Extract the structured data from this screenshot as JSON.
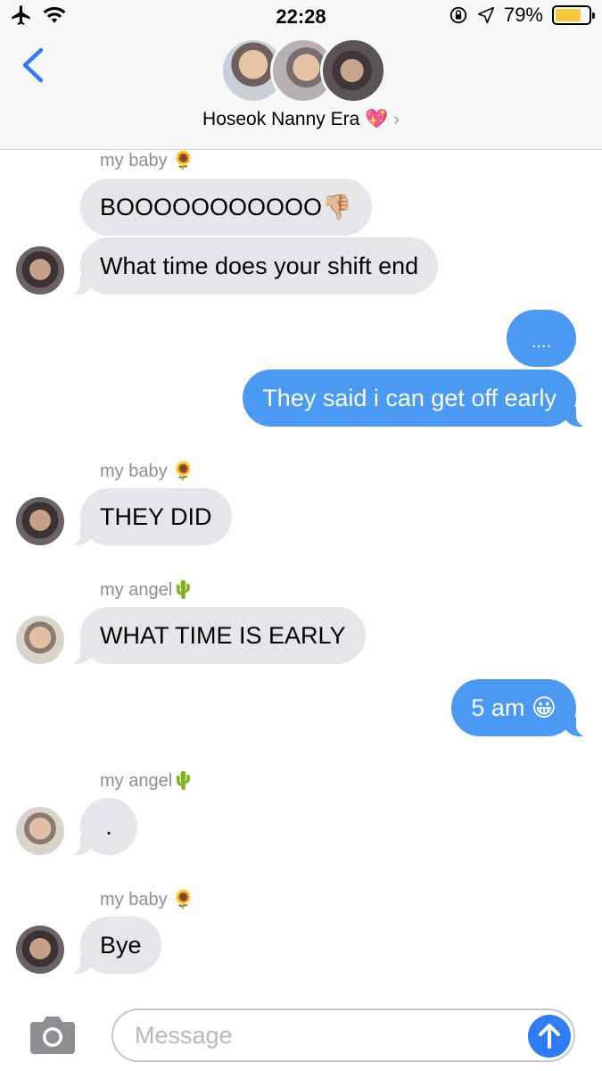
{
  "status_bar": {
    "time": "22:28",
    "battery_percent": "79%",
    "battery_level": 0.79
  },
  "header": {
    "title": "Hoseok Nanny Era 💖",
    "chevron": "›"
  },
  "messages": [
    {
      "sender": "my baby 🌻"
    },
    {
      "text": "BOOOOOOOOOOO👎🏼"
    },
    {
      "text": "What time does your shift end"
    },
    {
      "text": "...."
    },
    {
      "text": "They said i can get off early"
    },
    {
      "sender": "my baby 🌻"
    },
    {
      "text": "THEY DID"
    },
    {
      "sender": "my angel🌵"
    },
    {
      "text": "WHAT TIME IS EARLY"
    },
    {
      "text": "5 am 😀"
    },
    {
      "sender": "my angel🌵"
    },
    {
      "text": "."
    },
    {
      "sender": "my baby 🌻"
    },
    {
      "text": "Bye"
    }
  ],
  "input": {
    "placeholder": "Message"
  },
  "colors": {
    "outgoing": "#4a9af3",
    "incoming": "#e5e5ea",
    "accent": "#2f7cf6"
  },
  "icons": [
    "airplane-icon",
    "wifi-icon",
    "rotation-lock-icon",
    "location-icon",
    "battery-icon",
    "back-chevron-icon",
    "camera-icon",
    "send-arrow-icon"
  ]
}
